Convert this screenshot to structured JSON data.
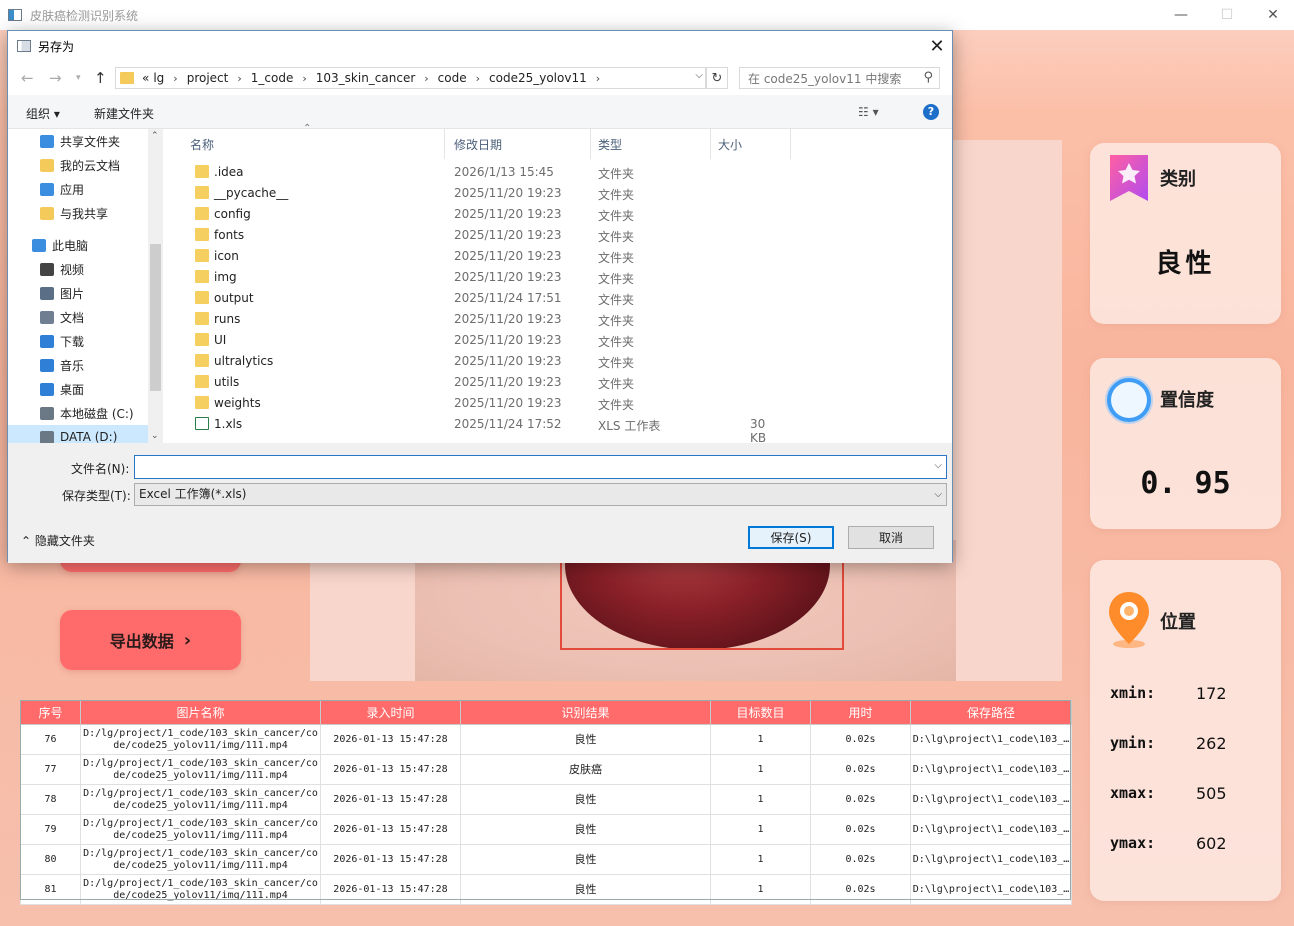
{
  "app": {
    "title": "皮肤癌检测识别系统",
    "minimize": "—",
    "maximize": "☐",
    "close": "✕"
  },
  "left_buttons": {
    "export_label": "导出数据",
    "chevron": "›"
  },
  "cards": {
    "category": {
      "title": "类别",
      "value": "良性"
    },
    "confidence": {
      "title": "置信度",
      "value": "0. 95"
    },
    "position": {
      "title": "位置",
      "rows": [
        {
          "label": "xmin:",
          "value": "172"
        },
        {
          "label": "ymin:",
          "value": "262"
        },
        {
          "label": "xmax:",
          "value": "505"
        },
        {
          "label": "ymax:",
          "value": "602"
        }
      ]
    }
  },
  "table": {
    "headers": [
      "序号",
      "图片名称",
      "录入时间",
      "识别结果",
      "目标数目",
      "用时",
      "保存路径"
    ],
    "rows": [
      [
        "76",
        "D:/lg/project/1_code/103_skin_cancer/code/code25_yolov11/img/111.mp4",
        "2026-01-13 15:47:28",
        "良性",
        "1",
        "0.02s",
        "D:\\lg\\project\\1_code\\103_…"
      ],
      [
        "77",
        "D:/lg/project/1_code/103_skin_cancer/code/code25_yolov11/img/111.mp4",
        "2026-01-13 15:47:28",
        "皮肤癌",
        "1",
        "0.02s",
        "D:\\lg\\project\\1_code\\103_…"
      ],
      [
        "78",
        "D:/lg/project/1_code/103_skin_cancer/code/code25_yolov11/img/111.mp4",
        "2026-01-13 15:47:28",
        "良性",
        "1",
        "0.02s",
        "D:\\lg\\project\\1_code\\103_…"
      ],
      [
        "79",
        "D:/lg/project/1_code/103_skin_cancer/code/code25_yolov11/img/111.mp4",
        "2026-01-13 15:47:28",
        "良性",
        "1",
        "0.02s",
        "D:\\lg\\project\\1_code\\103_…"
      ],
      [
        "80",
        "D:/lg/project/1_code/103_skin_cancer/code/code25_yolov11/img/111.mp4",
        "2026-01-13 15:47:28",
        "良性",
        "1",
        "0.02s",
        "D:\\lg\\project\\1_code\\103_…"
      ],
      [
        "81",
        "D:/lg/project/1_code/103_skin_cancer/code/code25_yolov11/img/111.mp4",
        "2026-01-13 15:47:28",
        "良性",
        "1",
        "0.02s",
        "D:\\lg\\project\\1_code\\103_…"
      ]
    ]
  },
  "dialog": {
    "title": "另存为",
    "close": "✕",
    "breadcrumb": [
      "«",
      "lg",
      "project",
      "1_code",
      "103_skin_cancer",
      "code",
      "code25_yolov11"
    ],
    "search_placeholder": "在 code25_yolov11 中搜索",
    "toolbar": {
      "organize": "组织 ▾",
      "new_folder": "新建文件夹",
      "view": "☷ ▾",
      "help": "?"
    },
    "nav_items": [
      {
        "label": "共享文件夹",
        "icon": "share-icon"
      },
      {
        "label": "我的云文档",
        "icon": "folder-icon"
      },
      {
        "label": "应用",
        "icon": "apps-icon"
      },
      {
        "label": "与我共享",
        "icon": "folder-icon"
      },
      {
        "label": "此电脑",
        "icon": "computer-icon"
      },
      {
        "label": "视频",
        "icon": "video-icon"
      },
      {
        "label": "图片",
        "icon": "pictures-icon"
      },
      {
        "label": "文档",
        "icon": "document-icon"
      },
      {
        "label": "下载",
        "icon": "download-icon"
      },
      {
        "label": "音乐",
        "icon": "music-icon"
      },
      {
        "label": "桌面",
        "icon": "desktop-icon"
      },
      {
        "label": "本地磁盘 (C:)",
        "icon": "drive-icon"
      },
      {
        "label": "DATA (D:)",
        "icon": "drive-icon"
      }
    ],
    "columns": [
      "名称",
      "修改日期",
      "类型",
      "大小"
    ],
    "files": [
      {
        "name": ".idea",
        "date": "2026/1/13 15:45",
        "type": "文件夹",
        "size": ""
      },
      {
        "name": "__pycache__",
        "date": "2025/11/20 19:23",
        "type": "文件夹",
        "size": ""
      },
      {
        "name": "config",
        "date": "2025/11/20 19:23",
        "type": "文件夹",
        "size": ""
      },
      {
        "name": "fonts",
        "date": "2025/11/20 19:23",
        "type": "文件夹",
        "size": ""
      },
      {
        "name": "icon",
        "date": "2025/11/20 19:23",
        "type": "文件夹",
        "size": ""
      },
      {
        "name": "img",
        "date": "2025/11/20 19:23",
        "type": "文件夹",
        "size": ""
      },
      {
        "name": "output",
        "date": "2025/11/24 17:51",
        "type": "文件夹",
        "size": ""
      },
      {
        "name": "runs",
        "date": "2025/11/20 19:23",
        "type": "文件夹",
        "size": ""
      },
      {
        "name": "UI",
        "date": "2025/11/20 19:23",
        "type": "文件夹",
        "size": ""
      },
      {
        "name": "ultralytics",
        "date": "2025/11/20 19:23",
        "type": "文件夹",
        "size": ""
      },
      {
        "name": "utils",
        "date": "2025/11/20 19:23",
        "type": "文件夹",
        "size": ""
      },
      {
        "name": "weights",
        "date": "2025/11/20 19:23",
        "type": "文件夹",
        "size": ""
      },
      {
        "name": "1.xls",
        "date": "2025/11/24 17:52",
        "type": "XLS 工作表",
        "size": "30 KB"
      }
    ],
    "filename_label": "文件名(N):",
    "filename_value": "",
    "filetype_label": "保存类型(T):",
    "filetype_value": "Excel 工作簿(*.xls)",
    "save_label": "保存(S)",
    "cancel_label": "取消",
    "hide_folders_label": "⌃ 隐藏文件夹"
  }
}
